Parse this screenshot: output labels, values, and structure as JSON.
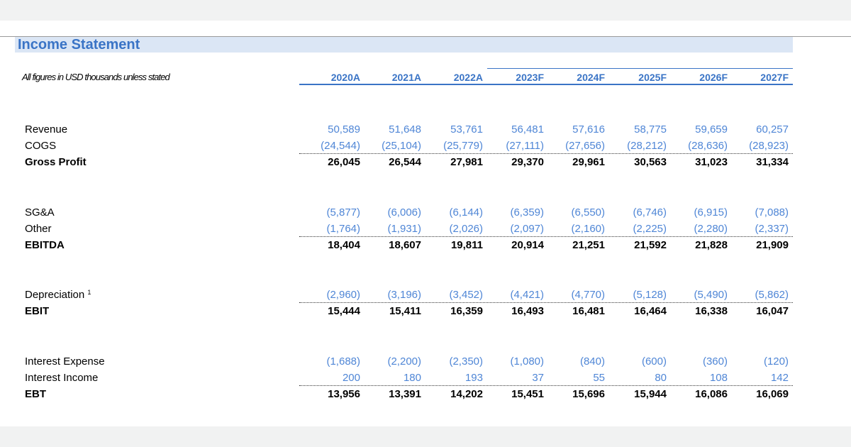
{
  "title": "Income Statement",
  "subtitle": "All figures in USD thousands unless stated",
  "years": [
    "2020A",
    "2021A",
    "2022A",
    "2023F",
    "2024F",
    "2025F",
    "2026F",
    "2027F"
  ],
  "rows": [
    {
      "label": "Revenue",
      "values": [
        "50,589",
        "51,648",
        "53,761",
        "56,481",
        "57,616",
        "58,775",
        "59,659",
        "60,257"
      ]
    },
    {
      "label": "COGS",
      "values": [
        "(24,544)",
        "(25,104)",
        "(25,779)",
        "(27,111)",
        "(27,656)",
        "(28,212)",
        "(28,636)",
        "(28,923)"
      ]
    },
    {
      "label": "Gross Profit",
      "values": [
        "26,045",
        "26,544",
        "27,981",
        "29,370",
        "29,961",
        "30,563",
        "31,023",
        "31,334"
      ]
    },
    {
      "label": "SG&A",
      "values": [
        "(5,877)",
        "(6,006)",
        "(6,144)",
        "(6,359)",
        "(6,550)",
        "(6,746)",
        "(6,915)",
        "(7,088)"
      ]
    },
    {
      "label": "Other",
      "values": [
        "(1,764)",
        "(1,931)",
        "(2,026)",
        "(2,097)",
        "(2,160)",
        "(2,225)",
        "(2,280)",
        "(2,337)"
      ]
    },
    {
      "label": "EBITDA",
      "values": [
        "18,404",
        "18,607",
        "19,811",
        "20,914",
        "21,251",
        "21,592",
        "21,828",
        "21,909"
      ]
    },
    {
      "label": "Depreciation",
      "footnote": "1",
      "values": [
        "(2,960)",
        "(3,196)",
        "(3,452)",
        "(4,421)",
        "(4,770)",
        "(5,128)",
        "(5,490)",
        "(5,862)"
      ]
    },
    {
      "label": "EBIT",
      "values": [
        "15,444",
        "15,411",
        "16,359",
        "16,493",
        "16,481",
        "16,464",
        "16,338",
        "16,047"
      ]
    },
    {
      "label": "Interest Expense",
      "values": [
        "(1,688)",
        "(2,200)",
        "(2,350)",
        "(1,080)",
        "(840)",
        "(600)",
        "(360)",
        "(120)"
      ]
    },
    {
      "label": "Interest Income",
      "values": [
        "200",
        "180",
        "193",
        "37",
        "55",
        "80",
        "108",
        "142"
      ]
    },
    {
      "label": "EBT",
      "values": [
        "13,956",
        "13,391",
        "14,202",
        "15,451",
        "15,696",
        "15,944",
        "16,086",
        "16,069"
      ]
    }
  ]
}
